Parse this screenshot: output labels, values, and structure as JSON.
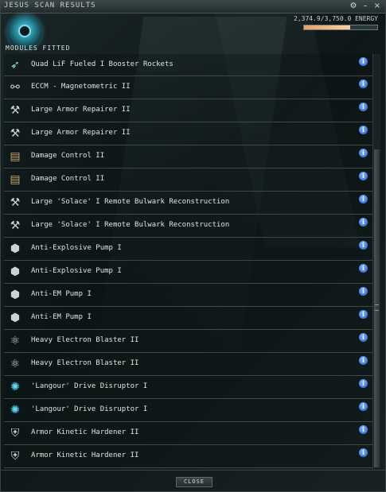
{
  "window": {
    "title": "JESUS SCAN RESULTS",
    "controls": {
      "settings": "⚙",
      "minimize": "–",
      "close": "×"
    }
  },
  "header": {
    "modules_label": "MODULES FITTED",
    "energy_text": "2,374.9/3,750.0  ENERGY",
    "energy_fraction": 0.633,
    "energy_color": "#e8a060"
  },
  "modules": [
    {
      "label": "Quad LiF Fueled I Booster Rockets",
      "icon": "booster-icon"
    },
    {
      "label": "ECCM - Magnetometric II",
      "icon": "eccm-icon"
    },
    {
      "label": "Large Armor Repairer II",
      "icon": "armor-repairer-icon"
    },
    {
      "label": "Large Armor Repairer II",
      "icon": "armor-repairer-icon"
    },
    {
      "label": "Damage Control II",
      "icon": "damage-control-icon"
    },
    {
      "label": "Damage Control II",
      "icon": "damage-control-icon"
    },
    {
      "label": "Large 'Solace' I Remote Bulwark Reconstruction",
      "icon": "remote-repairer-icon"
    },
    {
      "label": "Large 'Solace' I Remote Bulwark Reconstruction",
      "icon": "remote-repairer-icon"
    },
    {
      "label": "Anti-Explosive Pump I",
      "icon": "rig-icon"
    },
    {
      "label": "Anti-Explosive Pump I",
      "icon": "rig-icon"
    },
    {
      "label": "Anti-EM Pump I",
      "icon": "rig-icon"
    },
    {
      "label": "Anti-EM Pump I",
      "icon": "rig-icon"
    },
    {
      "label": "Heavy Electron Blaster II",
      "icon": "blaster-icon"
    },
    {
      "label": "Heavy Electron Blaster II",
      "icon": "blaster-icon"
    },
    {
      "label": "'Langour' Drive Disruptor I",
      "icon": "disruptor-icon"
    },
    {
      "label": "'Langour' Drive Disruptor I",
      "icon": "disruptor-icon"
    },
    {
      "label": "Armor Kinetic Hardener II",
      "icon": "hardener-icon"
    },
    {
      "label": "Armor Kinetic Hardener II",
      "icon": "hardener-icon"
    }
  ],
  "info_glyph": "i",
  "footer": {
    "close_label": "CLOSE"
  }
}
